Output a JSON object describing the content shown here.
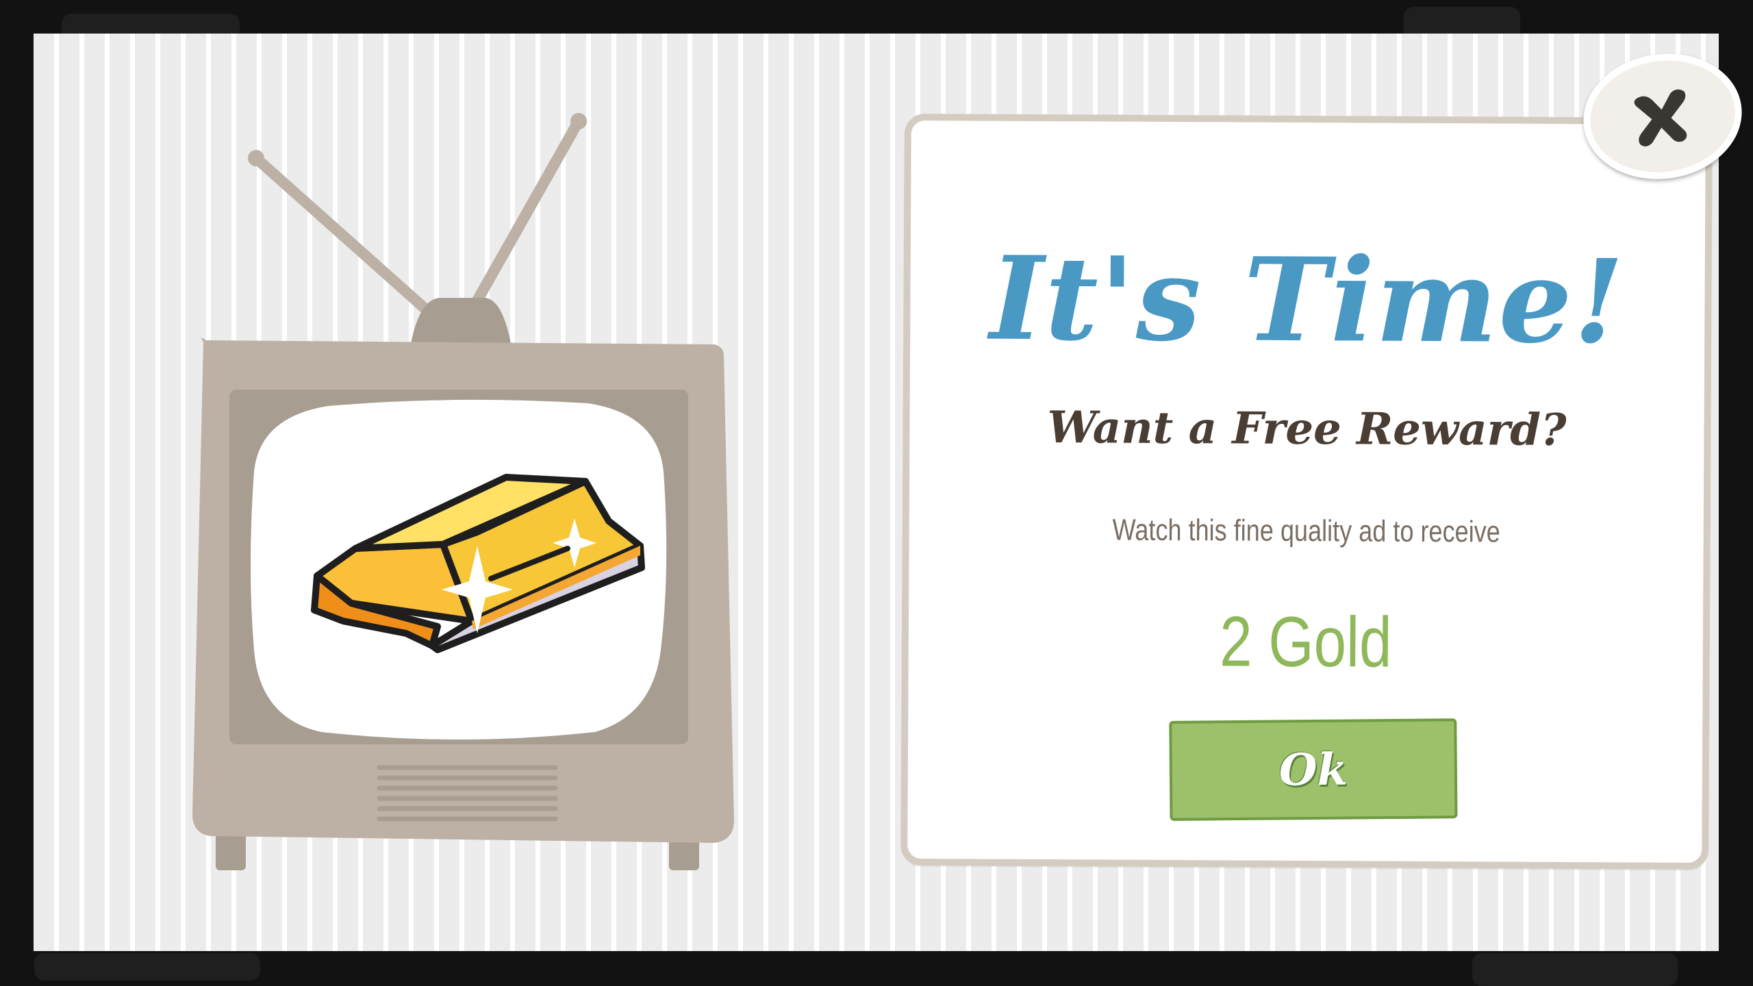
{
  "modal": {
    "title": "It's Time!",
    "subtitle": "Want a Free Reward?",
    "description": "Watch this fine quality ad to receive",
    "reward": "2 Gold",
    "ok_label": "Ok",
    "close_icon": "close-x-icon",
    "illustration": "tv-with-gold-bar"
  },
  "colors": {
    "title": "#4a98c4",
    "reward": "#8fb85a",
    "ok_button": "#9dc06b",
    "card_border": "#d4ccc1",
    "tv_body": "#bcb1a4"
  }
}
